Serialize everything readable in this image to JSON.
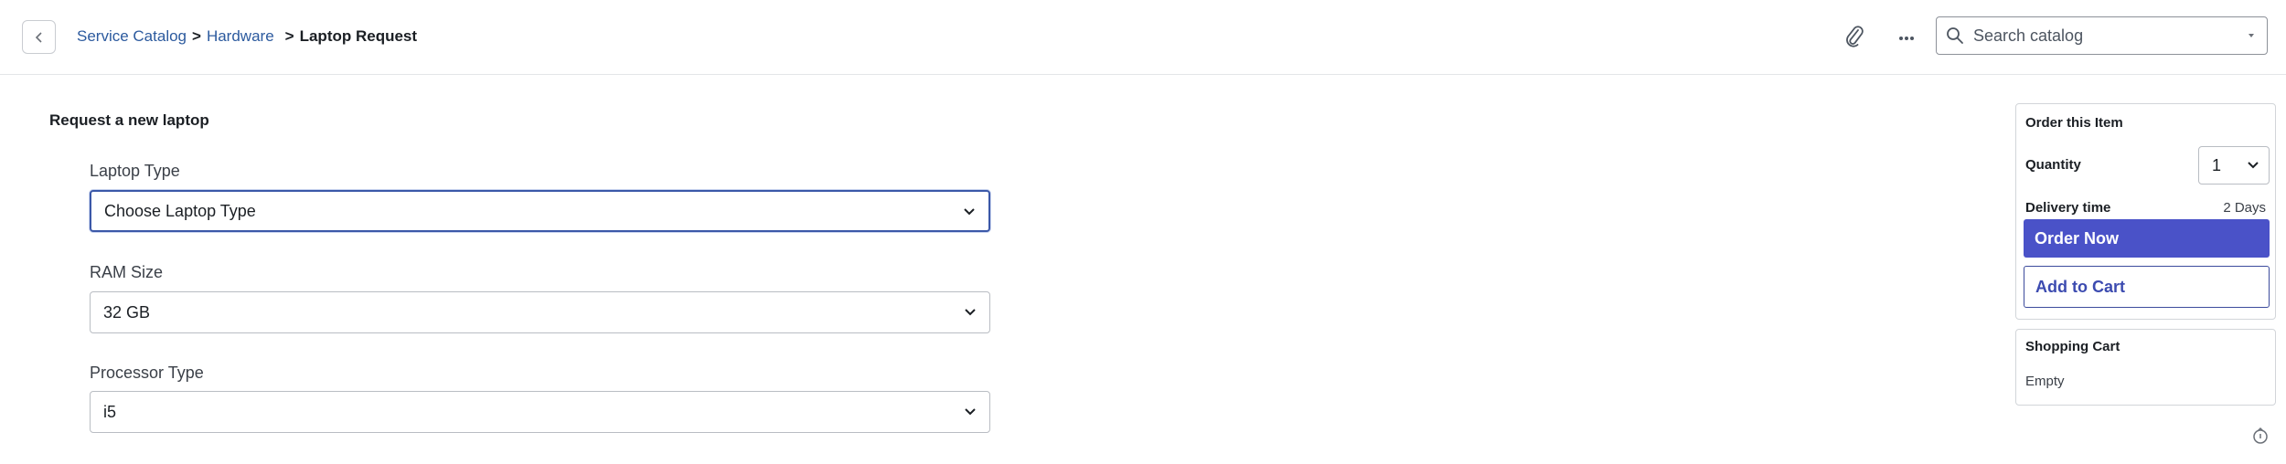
{
  "header": {
    "breadcrumb": [
      {
        "label": "Service Catalog"
      },
      {
        "label": "Hardware"
      },
      {
        "label": "Laptop Request"
      }
    ],
    "separator": ">",
    "search": {
      "placeholder": "Search catalog",
      "value": ""
    }
  },
  "form": {
    "title": "Request a new laptop",
    "fields": [
      {
        "label": "Laptop Type",
        "value": "Choose Laptop Type"
      },
      {
        "label": "RAM Size",
        "value": "32 GB"
      },
      {
        "label": "Processor Type",
        "value": "i5"
      }
    ]
  },
  "order": {
    "heading": "Order this Item",
    "quantity_label": "Quantity",
    "quantity_value": "1",
    "delivery_label": "Delivery time",
    "delivery_value": "2 Days",
    "order_now_label": "Order Now",
    "add_to_cart_label": "Add to Cart"
  },
  "cart": {
    "heading": "Shopping Cart",
    "status": "Empty"
  },
  "colors": {
    "accent": "#4a52c8",
    "link": "#2c5a9e",
    "focus_border": "#3b58a8"
  },
  "icons": [
    "back-arrow-icon",
    "paperclip-icon",
    "more-icon",
    "search-icon",
    "chevron-down-icon",
    "help-icon"
  ]
}
